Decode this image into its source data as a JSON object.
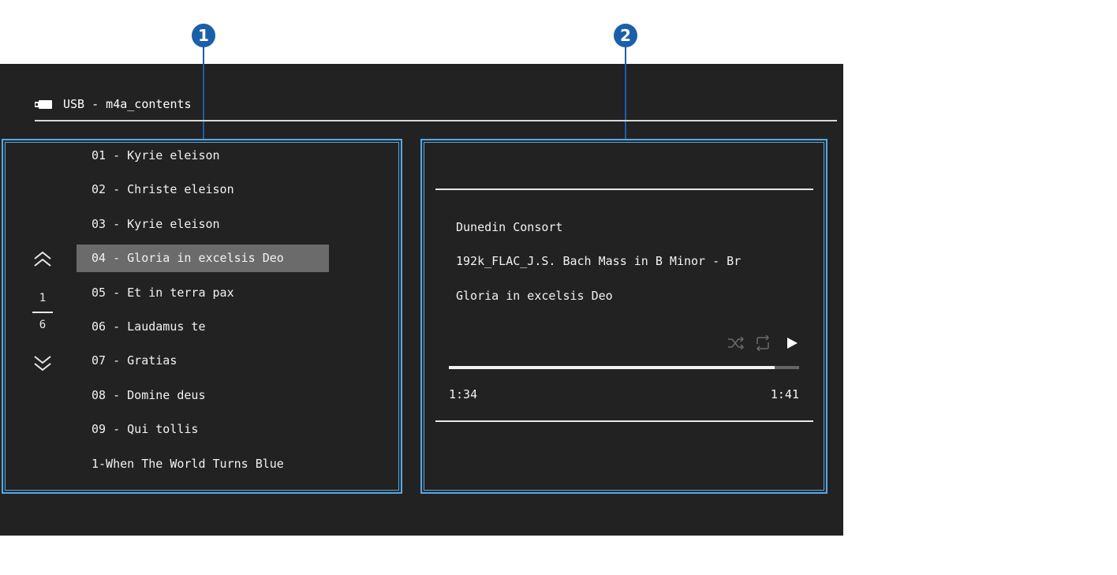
{
  "callouts": {
    "one": "1",
    "two": "2"
  },
  "header": {
    "source_icon": "usb-icon",
    "title": "USB - m4a_contents"
  },
  "list": {
    "tracks": [
      "01 - Kyrie eleison",
      "02 - Christe eleison",
      "03 - Kyrie eleison",
      "04 - Gloria in excelsis Deo",
      "05 - Et in terra pax",
      "06 - Laudamus te",
      "07 - Gratias",
      "08 - Domine deus",
      "09 - Qui tollis",
      "1-When The World Turns Blue"
    ],
    "selected_index": 3,
    "page_current": "1",
    "page_total": "6",
    "page_up_icon": "double-chevron-up-icon",
    "page_down_icon": "double-chevron-down-icon"
  },
  "now_playing": {
    "artist": "Dunedin Consort",
    "album": "192k_FLAC_J.S. Bach Mass in B Minor - Br",
    "track": "Gloria in excelsis Deo",
    "elapsed": "1:34",
    "total": "1:41",
    "progress_fraction": 0.931,
    "shuffle_icon": "shuffle-icon",
    "repeat_icon": "repeat-icon",
    "play_icon": "play-icon"
  },
  "colors": {
    "screen_bg": "#222222",
    "panel_border": "#5aa8e0",
    "callout": "#1b5fa8",
    "selection": "#6b6b6b",
    "text": "#f2f2f2"
  }
}
